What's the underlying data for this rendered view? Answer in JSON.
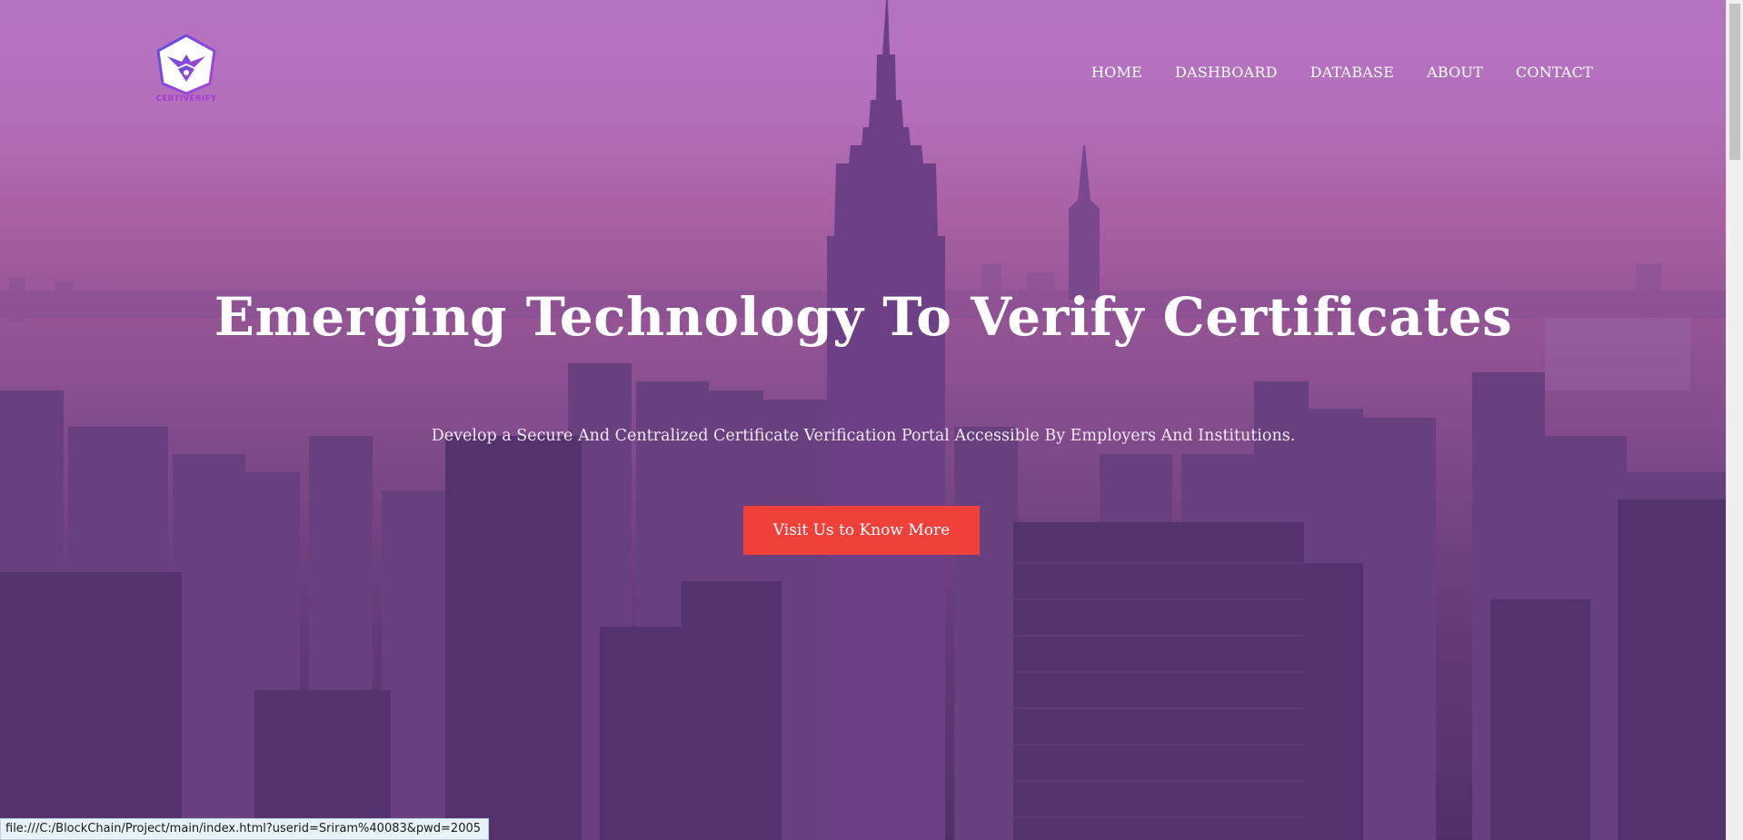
{
  "header": {
    "logo_text": "CERTIVERIFY",
    "nav": [
      {
        "label": "HOME"
      },
      {
        "label": "DASHBOARD"
      },
      {
        "label": "DATABASE"
      },
      {
        "label": "ABOUT"
      },
      {
        "label": "CONTACT"
      }
    ]
  },
  "hero": {
    "title": "Emerging Technology To Verify Certificates",
    "subtitle": "Develop a Secure And Centralized Certificate Verification Portal Accessible By Employers And Institutions.",
    "cta_label": "Visit Us to Know More"
  },
  "status_bar": {
    "url": "file:///C:/BlockChain/Project/main/index.html?userid=Sriram%40083&pwd=2005"
  },
  "colors": {
    "accent": "#f0403a",
    "logo": "#a43cd6",
    "hero_tint": "#b46aa7"
  }
}
